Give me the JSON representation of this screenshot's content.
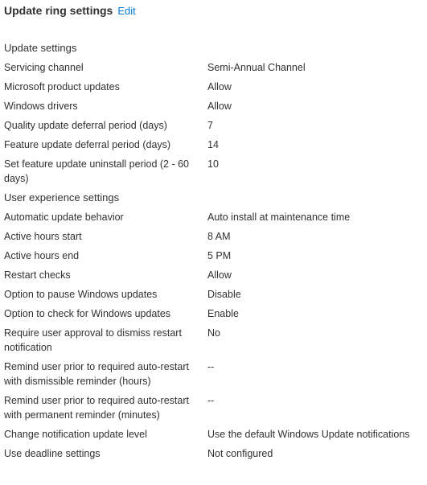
{
  "header": {
    "title": "Update ring settings",
    "edit_label": "Edit"
  },
  "sections": [
    {
      "title": "Update settings",
      "rows": [
        {
          "label": "Servicing channel",
          "value": "Semi-Annual Channel"
        },
        {
          "label": "Microsoft product updates",
          "value": "Allow"
        },
        {
          "label": "Windows drivers",
          "value": "Allow"
        },
        {
          "label": "Quality update deferral period (days)",
          "value": "7"
        },
        {
          "label": "Feature update deferral period (days)",
          "value": "14"
        },
        {
          "label": "Set feature update uninstall period (2 - 60 days)",
          "value": "10"
        }
      ]
    },
    {
      "title": "User experience settings",
      "rows": [
        {
          "label": "Automatic update behavior",
          "value": "Auto install at maintenance time"
        },
        {
          "label": "Active hours start",
          "value": "8 AM"
        },
        {
          "label": "Active hours end",
          "value": "5 PM"
        },
        {
          "label": "Restart checks",
          "value": "Allow"
        },
        {
          "label": "Option to pause Windows updates",
          "value": "Disable"
        },
        {
          "label": "Option to check for Windows updates",
          "value": "Enable"
        },
        {
          "label": "Require user approval to dismiss restart notification",
          "value": "No"
        },
        {
          "label": "Remind user prior to required auto-restart with dismissible reminder (hours)",
          "value": "--"
        },
        {
          "label": "Remind user prior to required auto-restart with permanent reminder (minutes)",
          "value": "--"
        },
        {
          "label": "Change notification update level",
          "value": "Use the default Windows Update notifications"
        },
        {
          "label": "Use deadline settings",
          "value": "Not configured"
        }
      ]
    }
  ]
}
